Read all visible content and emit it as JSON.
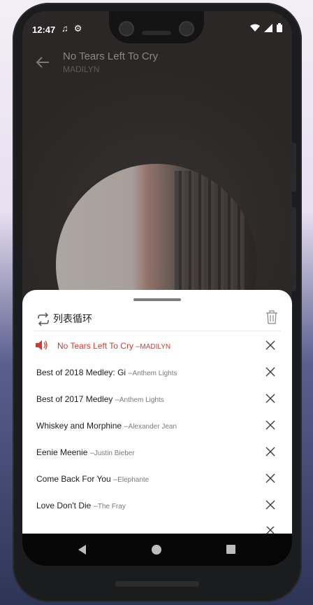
{
  "status_bar": {
    "time": "12:47"
  },
  "player": {
    "title": "No Tears Left To Cry",
    "artist": "MADILYN"
  },
  "sheet": {
    "repeat_mode_label": "列表循环",
    "queue": [
      {
        "title": "No Tears Left To Cry",
        "artist": "MADILYN",
        "playing": true
      },
      {
        "title": "Best of 2018 Medley: Gi",
        "artist": "Anthem Lights",
        "playing": false
      },
      {
        "title": "Best of 2017 Medley",
        "artist": "Anthem Lights",
        "playing": false
      },
      {
        "title": "Whiskey and Morphine",
        "artist": "Alexander Jean",
        "playing": false
      },
      {
        "title": "Eenie Meenie",
        "artist": "Justin Bieber",
        "playing": false
      },
      {
        "title": "Come Back For You",
        "artist": "Elephante",
        "playing": false
      },
      {
        "title": "Love Don't Die",
        "artist": "The Fray",
        "playing": false
      }
    ],
    "separator": "–"
  },
  "icons": {
    "back": "arrow-left-icon",
    "repeat": "repeat-icon",
    "trash": "trash-icon",
    "now_playing": "speaker-icon",
    "remove": "close-icon"
  },
  "colors": {
    "accent_playing": "#d33a2f",
    "sheet_bg": "#ffffff",
    "player_bg": "#2b2726"
  }
}
